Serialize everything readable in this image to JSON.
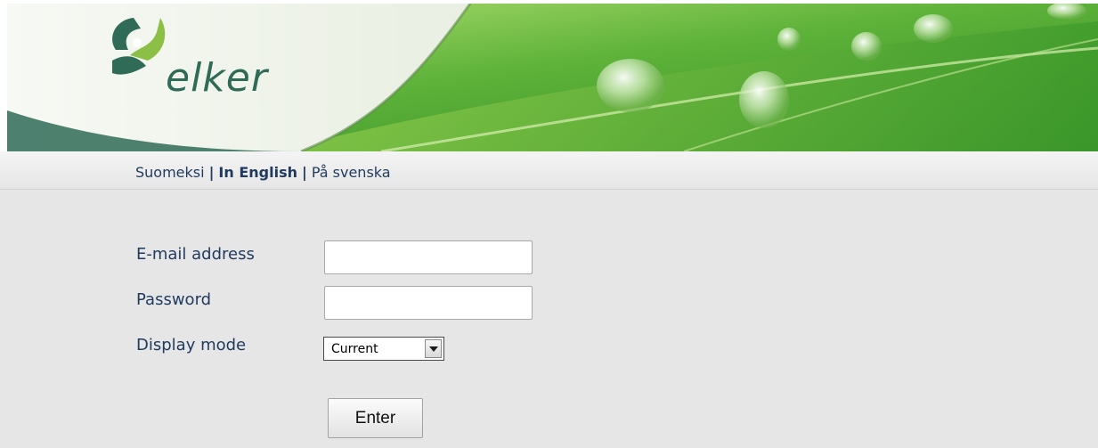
{
  "brand": {
    "logo_text": "elker",
    "colors": {
      "primary": "#2f6b56",
      "accent": "#8cbf45",
      "banner": "#4fa735"
    }
  },
  "languages": {
    "items": [
      {
        "label": "Suomeksi",
        "active": false
      },
      {
        "label": "In English",
        "active": true
      },
      {
        "label": "På svenska",
        "active": false
      }
    ],
    "separator": "|"
  },
  "form": {
    "email_label": "E-mail address",
    "email_value": "",
    "password_label": "Password",
    "password_value": "",
    "display_mode_label": "Display mode",
    "display_mode_value": "Current",
    "submit_label": "Enter"
  }
}
